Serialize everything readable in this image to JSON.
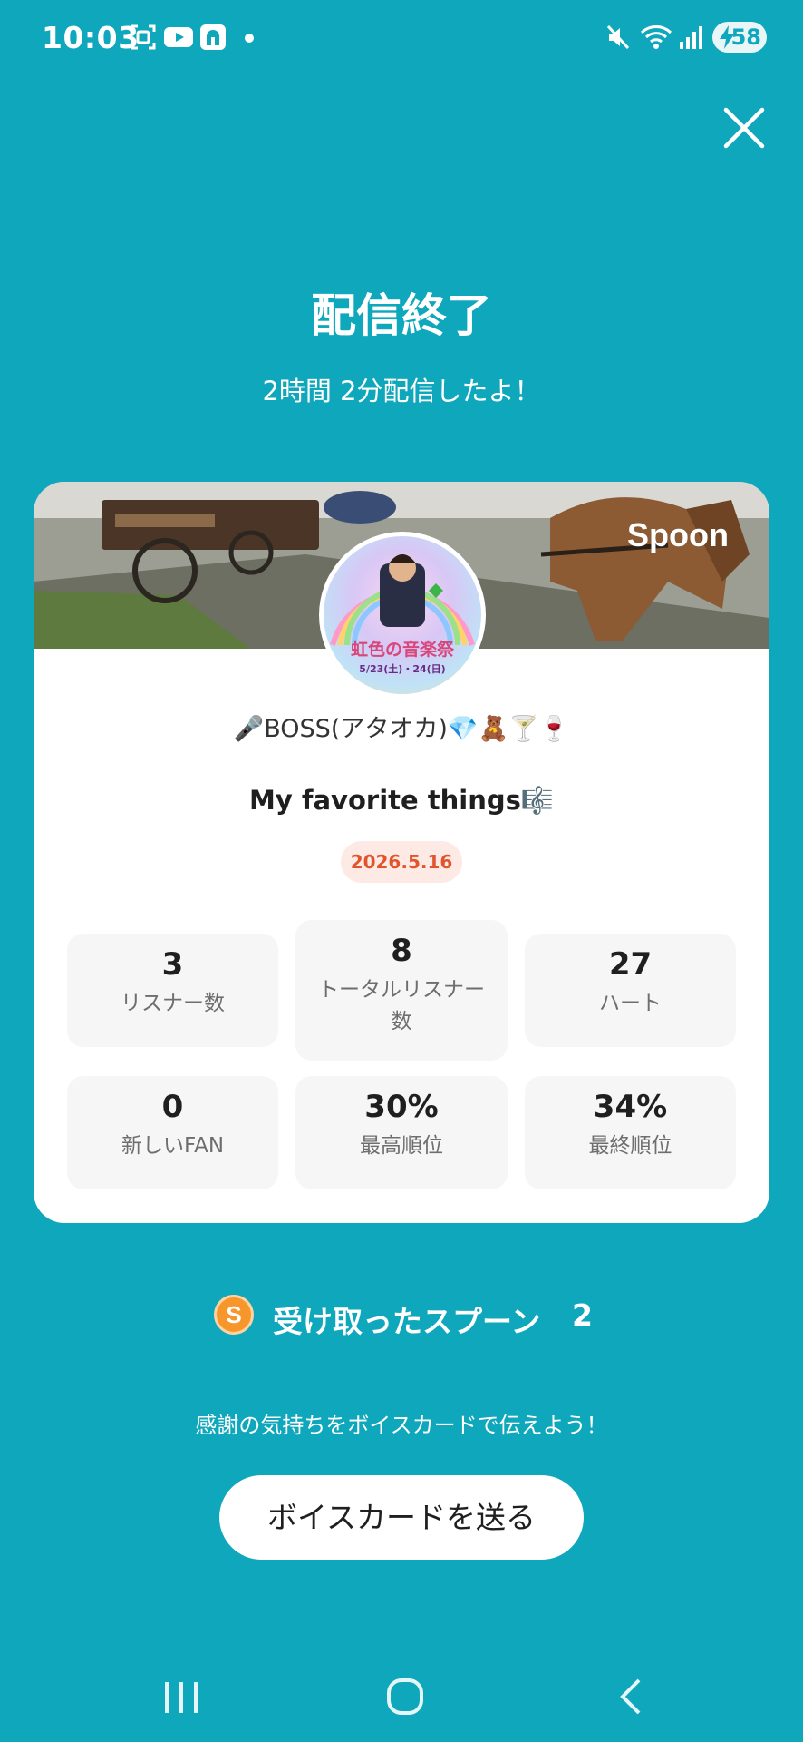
{
  "status_bar": {
    "time": "10:03",
    "battery": "58"
  },
  "header": {
    "title": "配信終了",
    "subtitle": "2時間 2分配信したよ！"
  },
  "card": {
    "brand": "Spoon",
    "avatar": {
      "top_text": "虹色の音楽祭",
      "date_text": "5/23(土)・24(日)"
    },
    "dj_name": "🎤BOSS(アタオカ)💎🧸🍸🍷",
    "live_title": "My favorite things🎼",
    "date": "2026.5.16",
    "stats": [
      {
        "value": "3",
        "label": "リスナー数"
      },
      {
        "value": "8",
        "label": "トータルリスナー数"
      },
      {
        "value": "27",
        "label": "ハート"
      },
      {
        "value": "0",
        "label": "新しいFAN"
      },
      {
        "value": "30%",
        "label": "最高順位"
      },
      {
        "value": "34%",
        "label": "最終順位"
      }
    ]
  },
  "spoons": {
    "coin": "S",
    "label": "受け取ったスプーン",
    "count": "2"
  },
  "thanks_text": "感謝の気持ちをボイスカードで伝えよう！",
  "voice_card_button": "ボイスカードを送る",
  "colors": {
    "background": "#0EA7BC",
    "accent": "#E2542B",
    "coin": "#F7962B"
  }
}
